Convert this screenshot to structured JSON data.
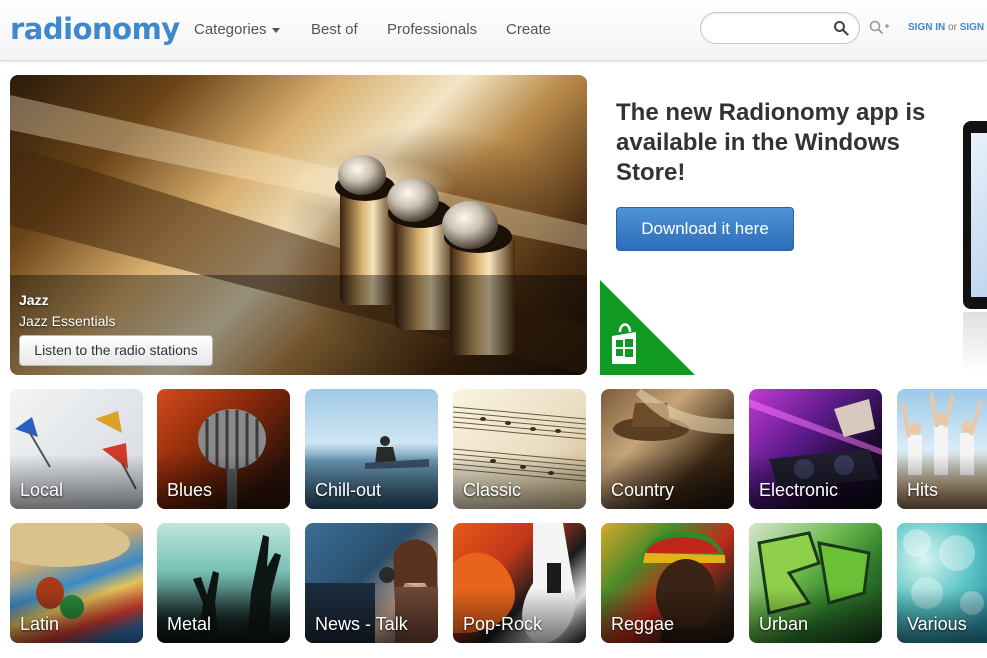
{
  "header": {
    "logo": "radionomy",
    "nav": [
      {
        "label": "Categories",
        "has_dropdown": true
      },
      {
        "label": "Best of"
      },
      {
        "label": "Professionals"
      },
      {
        "label": "Create"
      }
    ],
    "search": {
      "value": "",
      "placeholder": ""
    },
    "signin": {
      "sign_in": "SIGN IN",
      "or": "or",
      "sign_up": "SIGN"
    }
  },
  "hero": {
    "genre": "Jazz",
    "subtitle": "Jazz Essentials",
    "button": "Listen to the radio stations"
  },
  "promo": {
    "title": "The new Radionomy app is available in the Windows Store!",
    "button": "Download it here",
    "badge_color": "#119a23"
  },
  "genres": {
    "row1": [
      "Local",
      "Blues",
      "Chill-out",
      "Classic",
      "Country",
      "Electronic",
      "Hits"
    ],
    "row2": [
      "Latin",
      "Metal",
      "News - Talk",
      "Pop-Rock",
      "Reggae",
      "Urban",
      "Various"
    ]
  },
  "colors": {
    "brand_blue": "#3e88cc",
    "download_button": "#3b80c9"
  }
}
